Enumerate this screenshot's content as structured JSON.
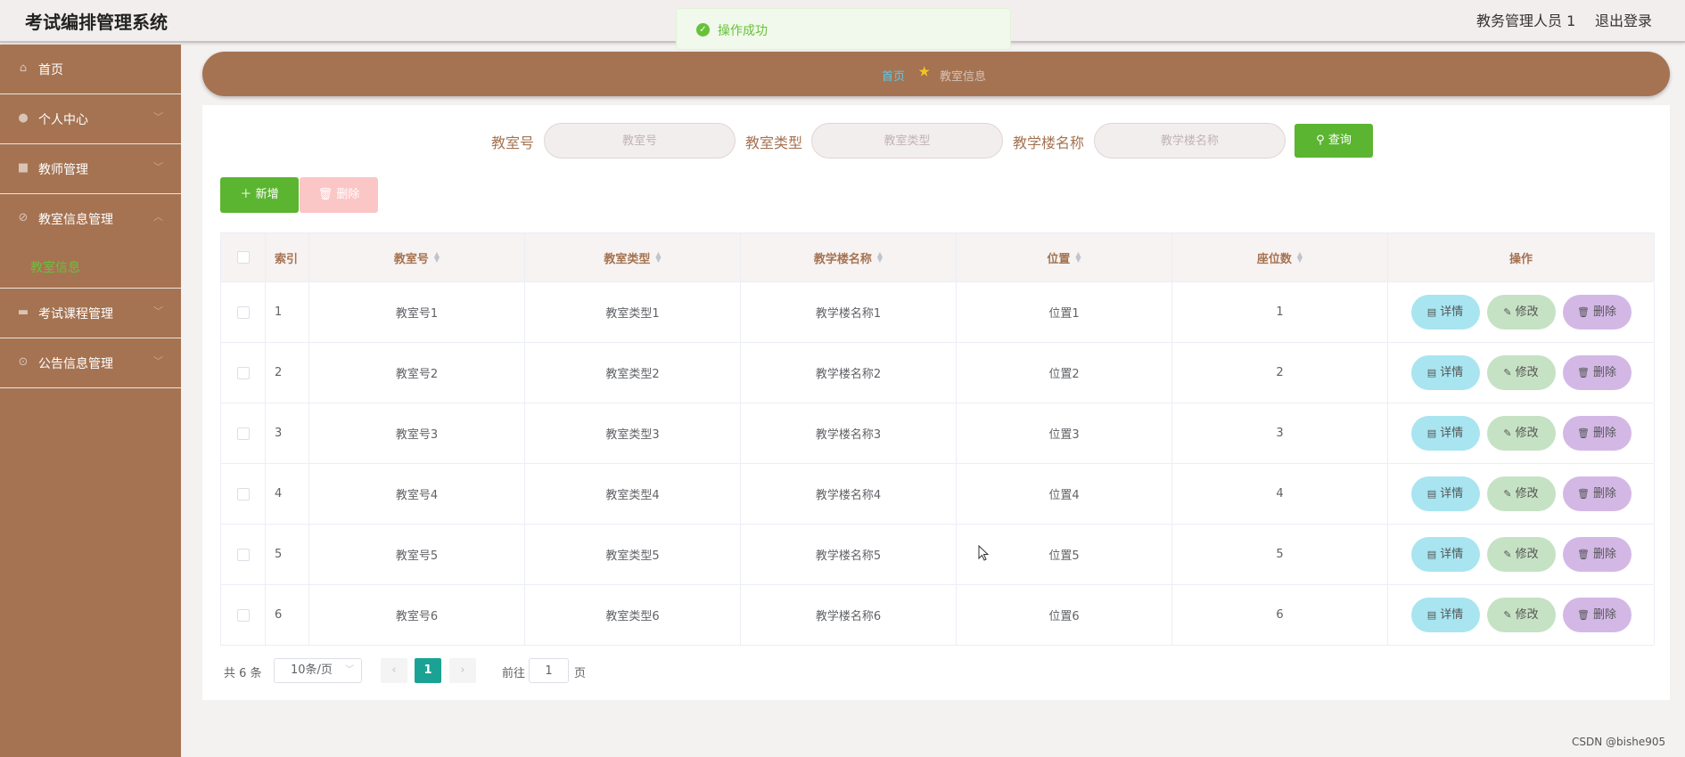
{
  "header": {
    "title": "考试编排管理系统",
    "user": "教务管理人员 1",
    "logout": "退出登录"
  },
  "toast": {
    "message": "操作成功",
    "icon": "check-circle-icon"
  },
  "sidebar": {
    "items": [
      {
        "label": "首页",
        "icon": "home-icon",
        "arrow": ""
      },
      {
        "label": "个人中心",
        "icon": "user-icon",
        "arrow": "﹀"
      },
      {
        "label": "教师管理",
        "icon": "briefcase-icon",
        "arrow": "﹀"
      },
      {
        "label": "教室信息管理",
        "icon": "compass-icon",
        "arrow": "︿"
      },
      {
        "label": "考试课程管理",
        "icon": "ticket-icon",
        "arrow": "﹀"
      },
      {
        "label": "公告信息管理",
        "icon": "compass-icon",
        "arrow": "﹀"
      }
    ],
    "subitem": {
      "label": "教室信息"
    }
  },
  "breadcrumb": {
    "home": "首页",
    "current": "教室信息"
  },
  "search": {
    "field1": {
      "label": "教室号",
      "placeholder": "教室号",
      "value": ""
    },
    "field2": {
      "label": "教室类型",
      "placeholder": "教室类型",
      "value": ""
    },
    "field3": {
      "label": "教学楼名称",
      "placeholder": "教学楼名称",
      "value": ""
    },
    "query_label": "查询"
  },
  "toolbar": {
    "add_label": "新增",
    "delete_label": "删除"
  },
  "table": {
    "headers": {
      "index": "索引",
      "col1": "教室号",
      "col2": "教室类型",
      "col3": "教学楼名称",
      "col4": "位置",
      "col5": "座位数",
      "ops": "操作"
    },
    "rows": [
      {
        "index": "1",
        "col1": "教室号1",
        "col2": "教室类型1",
        "col3": "教学楼名称1",
        "col4": "位置1",
        "col5": "1"
      },
      {
        "index": "2",
        "col1": "教室号2",
        "col2": "教室类型2",
        "col3": "教学楼名称2",
        "col4": "位置2",
        "col5": "2"
      },
      {
        "index": "3",
        "col1": "教室号3",
        "col2": "教室类型3",
        "col3": "教学楼名称3",
        "col4": "位置3",
        "col5": "3"
      },
      {
        "index": "4",
        "col1": "教室号4",
        "col2": "教室类型4",
        "col3": "教学楼名称4",
        "col4": "位置4",
        "col5": "4"
      },
      {
        "index": "5",
        "col1": "教室号5",
        "col2": "教室类型5",
        "col3": "教学楼名称5",
        "col4": "位置5",
        "col5": "5"
      },
      {
        "index": "6",
        "col1": "教室号6",
        "col2": "教室类型6",
        "col3": "教学楼名称6",
        "col4": "位置6",
        "col5": "6"
      }
    ],
    "actions": {
      "detail": "详情",
      "edit": "修改",
      "delete": "删除"
    }
  },
  "pagination": {
    "total": "共 6 条",
    "page_size": "10条/页",
    "current_page": "1",
    "goto_prefix": "前往",
    "goto_value": "1",
    "goto_suffix": "页"
  },
  "watermark": "CSDN @bishe905",
  "colors": {
    "brand": "#a57352",
    "accent_green": "#5cb531",
    "page_active": "#1aa394"
  }
}
